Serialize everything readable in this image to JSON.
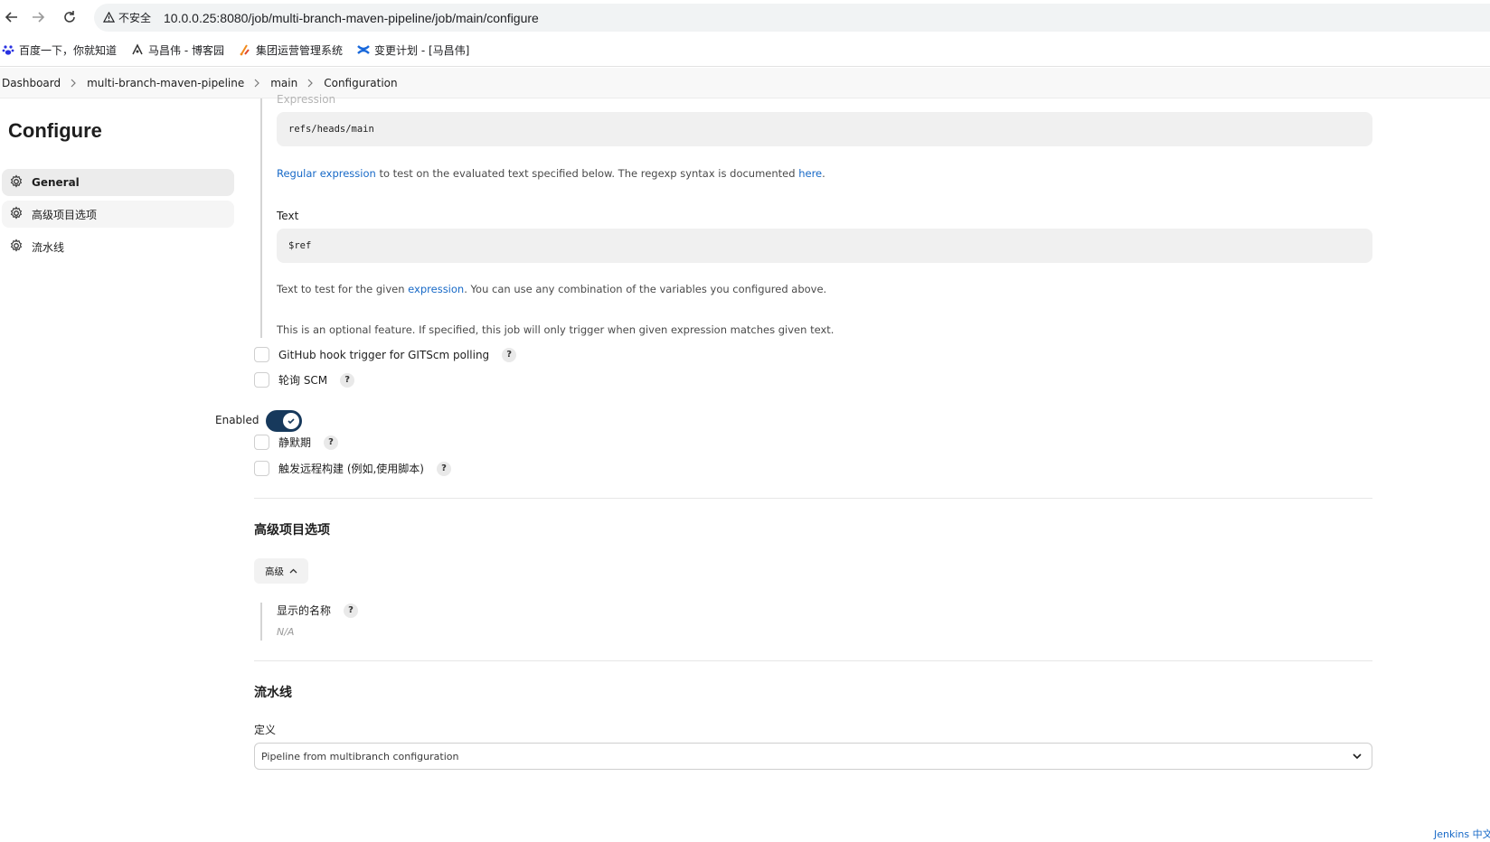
{
  "browser": {
    "insecure_label": "不安全",
    "url": "10.0.0.25:8080/job/multi-branch-maven-pipeline/job/main/configure",
    "bookmarks": [
      {
        "label": "百度一下，你就知道",
        "icon": "baidu-paw-icon"
      },
      {
        "label": "马昌伟 - 博客园",
        "icon": "cnblogs-icon"
      },
      {
        "label": "集团运营管理系统",
        "icon": "system-icon"
      },
      {
        "label": "变更计划 - [马昌伟]",
        "icon": "confluence-icon"
      }
    ]
  },
  "breadcrumb": [
    "Dashboard",
    "multi-branch-maven-pipeline",
    "main",
    "Configuration"
  ],
  "sidebar": {
    "title": "Configure",
    "items": [
      {
        "label": "General",
        "icon": "gear-icon"
      },
      {
        "label": "高级项目选项",
        "icon": "gear-icon"
      },
      {
        "label": "流水线",
        "icon": "gear-icon"
      }
    ]
  },
  "trigger": {
    "expression_label": "Expression",
    "expression_value": "refs/heads/main",
    "expression_help": {
      "link1": "Regular expression",
      "middle": " to test on the evaluated text specified below. The regexp syntax is documented ",
      "link2": "here",
      "end": "."
    },
    "text_label": "Text",
    "text_value": "$ref",
    "text_help": {
      "start": "Text to test for the given ",
      "link": "expression",
      "end": ". You can use any combination of the variables you configured above."
    },
    "optional_note": "This is an optional feature. If specified, this job will only trigger when given expression matches given text."
  },
  "build_triggers": [
    {
      "label": "GitHub hook trigger for GITScm polling",
      "checked": false
    },
    {
      "label": "轮询 SCM",
      "checked": false
    }
  ],
  "enabled": {
    "label": "Enabled",
    "on": true
  },
  "more_triggers": [
    {
      "label": "静默期",
      "checked": false
    },
    {
      "label": "触发远程构建 (例如,使用脚本)",
      "checked": false
    }
  ],
  "advanced_section": {
    "title": "高级项目选项",
    "button_label": "高级",
    "display_name_label": "显示的名称",
    "display_name_value": "N/A"
  },
  "pipeline_section": {
    "title": "流水线",
    "definition_label": "定义",
    "definition_value": "Pipeline from multibranch configuration"
  },
  "footer": {
    "link": "Jenkins 中文社区"
  },
  "colors": {
    "accent": "#17395c",
    "link": "#1769c7"
  }
}
